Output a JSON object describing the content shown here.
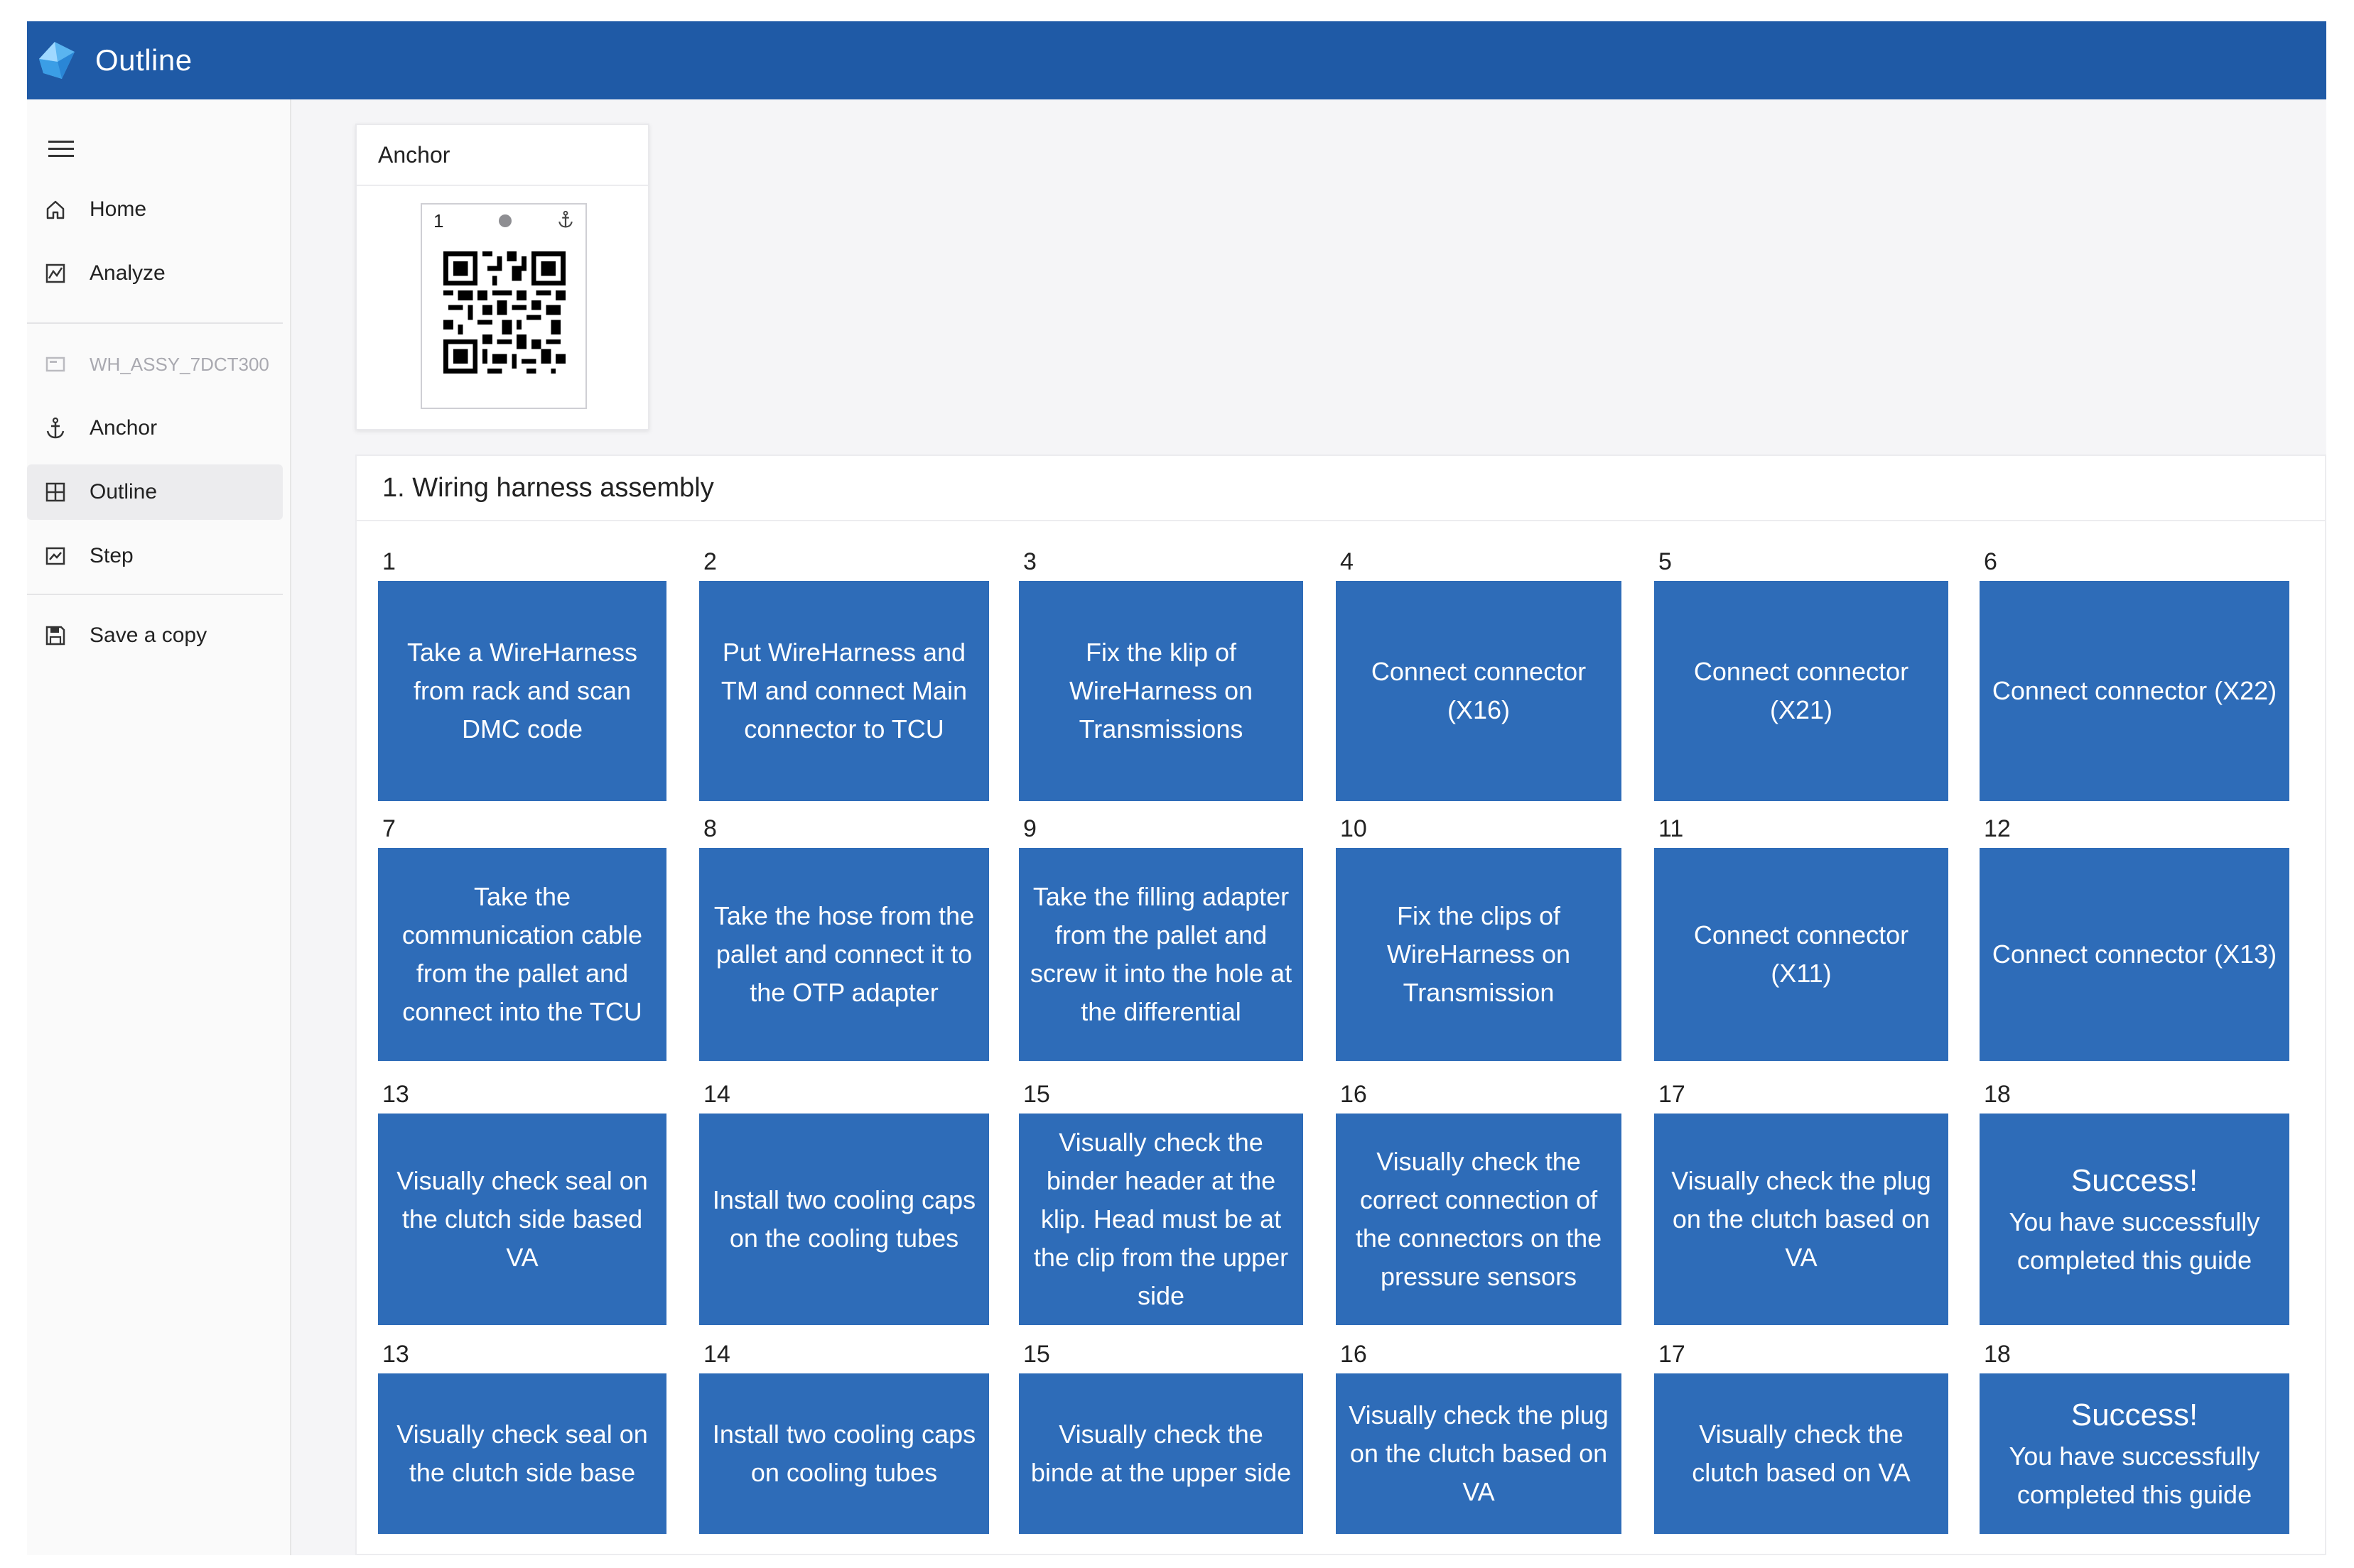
{
  "app": {
    "title": "Outline"
  },
  "sidebar": {
    "items": [
      {
        "label": "Home",
        "icon": "home-icon"
      },
      {
        "label": "Analyze",
        "icon": "analyze-icon"
      },
      {
        "label": "WH_ASSY_7DCT300",
        "icon": "document-icon",
        "disabled": true
      },
      {
        "label": "Anchor",
        "icon": "anchor-icon"
      },
      {
        "label": "Outline",
        "icon": "outline-icon",
        "active": true
      },
      {
        "label": "Step",
        "icon": "step-icon"
      },
      {
        "label": "Save a copy",
        "icon": "save-icon"
      }
    ]
  },
  "anchor": {
    "header": "Anchor",
    "tile_number": "1"
  },
  "section": {
    "title": "1.  Wiring harness assembly",
    "rows": [
      [
        {
          "num": "1",
          "text": "Take a WireHarness from rack and scan DMC code"
        },
        {
          "num": "2",
          "text": "Put WireHarness and TM and connect Main connector to TCU"
        },
        {
          "num": "3",
          "text": "Fix the klip of WireHarness on Transmissions"
        },
        {
          "num": "4",
          "text": "Connect connector (X16)"
        },
        {
          "num": "5",
          "text": "Connect connector (X21)"
        },
        {
          "num": "6",
          "text": "Connect connector (X22)"
        }
      ],
      [
        {
          "num": "7",
          "text": "Take the communication cable from the pallet and connect into the TCU"
        },
        {
          "num": "8",
          "text": "Take the hose from the pallet and connect it to the OTP adapter"
        },
        {
          "num": "9",
          "text": "Take the filling adapter from the pallet and screw it into the hole at the differential"
        },
        {
          "num": "10",
          "text": "Fix the clips of WireHarness on Transmission"
        },
        {
          "num": "11",
          "text": "Connect connector (X11)"
        },
        {
          "num": "12",
          "text": "Connect connector (X13)"
        }
      ],
      [
        {
          "num": "13",
          "text": "Visually check seal on the clutch side based VA"
        },
        {
          "num": "14",
          "text": "Install two cooling caps on the cooling tubes"
        },
        {
          "num": "15",
          "text": "Visually check the binder header at the klip. Head must be at the clip from the upper side"
        },
        {
          "num": "16",
          "text": "Visually check the correct connection of the connectors on the pressure sensors"
        },
        {
          "num": "17",
          "text": "Visually check the plug on the clutch based on VA"
        },
        {
          "num": "18",
          "title": "Success!",
          "text": "You have successfully completed this guide"
        }
      ],
      [
        {
          "num": "13",
          "text": "Visually check seal on the clutch side base"
        },
        {
          "num": "14",
          "text": "Install two cooling caps on cooling tubes"
        },
        {
          "num": "15",
          "text": "Visually check the binde at the upper side"
        },
        {
          "num": "16",
          "text": "Visually check the plug on the clutch based on VA"
        },
        {
          "num": "17",
          "text": "Visually check the clutch based on VA"
        },
        {
          "num": "18",
          "title": "Success!",
          "text": "You have successfully completed this guide"
        }
      ]
    ]
  },
  "colors": {
    "header": "#1f5aa6",
    "tile": "#2e6cb8",
    "sidebar_bg": "#fafafa",
    "active_nav": "#ececee"
  }
}
